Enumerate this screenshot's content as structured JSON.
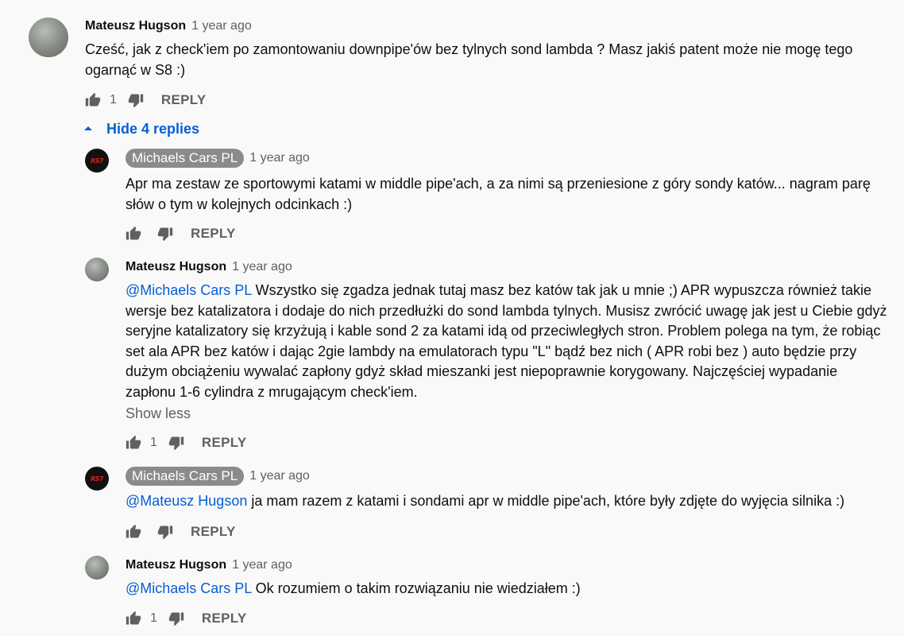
{
  "icons": {
    "like": "thumb-up-icon",
    "dislike": "thumb-down-icon",
    "collapse": "caret-up-icon"
  },
  "colors": {
    "link": "#065fd4",
    "secondary_text": "#606060",
    "owner_badge": "#8b8b8b",
    "background": "#f9f9f9"
  },
  "top_comment": {
    "author": "Mateusz Hugson",
    "time": "1 year ago",
    "text": "Cześć, jak z check'iem po zamontowaniu downpipe'ów bez tylnych sond lambda ? Masz jakiś patent może nie mogę tego ogarnąć w S8 :)",
    "likes": "1",
    "reply_label": "REPLY"
  },
  "hide_replies_label": "Hide 4 replies",
  "replies": [
    {
      "author": "Michaels Cars PL",
      "time": "1 year ago",
      "mention": "",
      "text": "Apr ma zestaw ze sportowymi katami w middle pipe'ach, a za nimi są przeniesione z góry sondy katów... nagram parę słów o tym w kolejnych odcinkach :)",
      "likes": "",
      "reply_label": "REPLY"
    },
    {
      "author": "Mateusz Hugson",
      "time": "1 year ago",
      "mention": "@Michaels Cars PL",
      "text": " Wszystko się zgadza jednak tutaj masz bez katów tak jak u mnie ;) APR wypuszcza również takie wersje bez katalizatora i dodaje do nich przedłużki do sond lambda tylnych. Musisz zwrócić uwagę jak jest u Ciebie gdyż seryjne katalizatory się krzyżują i kable sond 2 za katami idą od przeciwległych stron. Problem polega na tym, że robiąc set ala APR bez katów i dając 2gie lambdy na emulatorach typu \"L\" bądź bez nich ( APR robi bez ) auto będzie przy dużym obciążeniu wywalać zapłony gdyż skład mieszanki jest niepoprawnie korygowany. Najczęściej wypadanie zapłonu 1-6 cylindra z mrugającym check'iem.",
      "show_less": "Show less",
      "likes": "1",
      "reply_label": "REPLY"
    },
    {
      "author": "Michaels Cars PL",
      "time": "1 year ago",
      "mention": "@Mateusz Hugson",
      "text": " ja mam razem z katami i sondami apr w middle pipe'ach, które były zdjęte do wyjęcia silnika :)",
      "likes": "",
      "reply_label": "REPLY"
    },
    {
      "author": "Mateusz Hugson",
      "time": "1 year ago",
      "mention": "@Michaels Cars PL",
      "text": " Ok rozumiem o takim rozwiązaniu nie wiedziałem :)",
      "likes": "1",
      "reply_label": "REPLY"
    }
  ]
}
